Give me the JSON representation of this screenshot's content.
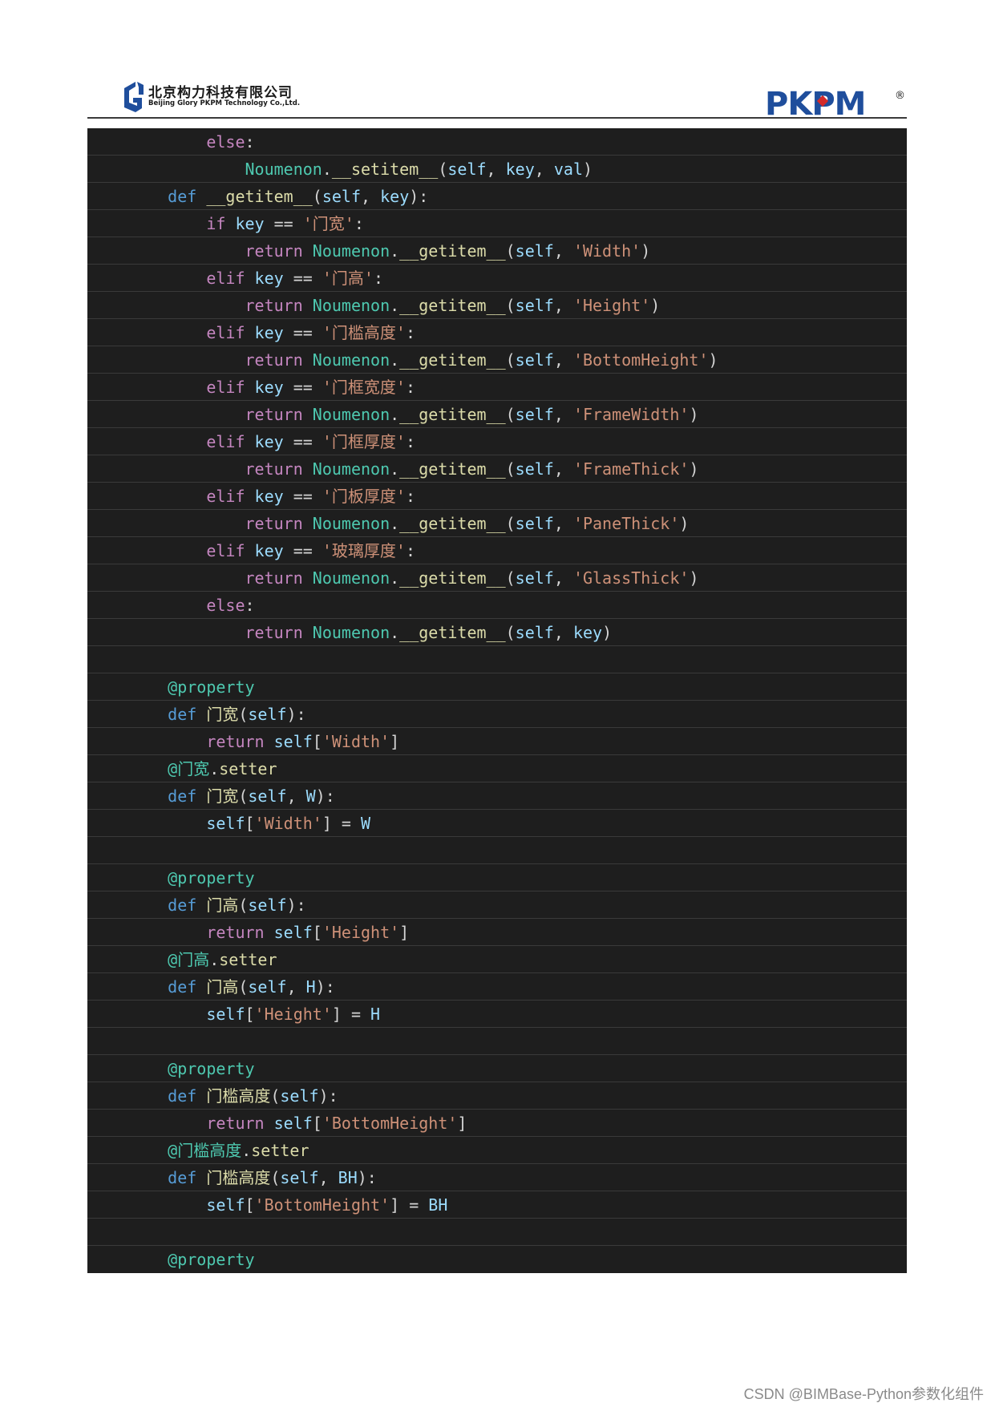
{
  "header": {
    "company_cn": "北京构力科技有限公司",
    "company_en": "Beijing Glory PKPM Technology Co.,Ltd.",
    "brand": "PKPM",
    "brand_mark": "®"
  },
  "code_lines": [
    [
      [
        "        ",
        "p"
      ],
      [
        "else",
        "kw"
      ],
      [
        ":",
        "p"
      ]
    ],
    [
      [
        "            ",
        "p"
      ],
      [
        "Noumenon",
        "cls"
      ],
      [
        ".",
        "p"
      ],
      [
        "__setitem__",
        "fn"
      ],
      [
        "(",
        "p"
      ],
      [
        "self",
        "var"
      ],
      [
        ", ",
        "p"
      ],
      [
        "key",
        "var"
      ],
      [
        ", ",
        "p"
      ],
      [
        "val",
        "var"
      ],
      [
        ")",
        "p"
      ]
    ],
    [
      [
        "    ",
        "p"
      ],
      [
        "def",
        "def"
      ],
      [
        " ",
        "p"
      ],
      [
        "__getitem__",
        "fn"
      ],
      [
        "(",
        "p"
      ],
      [
        "self",
        "var"
      ],
      [
        ", ",
        "p"
      ],
      [
        "key",
        "var"
      ],
      [
        "):",
        "p"
      ]
    ],
    [
      [
        "        ",
        "p"
      ],
      [
        "if",
        "kw"
      ],
      [
        " ",
        "p"
      ],
      [
        "key",
        "var"
      ],
      [
        " == ",
        "p"
      ],
      [
        "'门宽'",
        "str"
      ],
      [
        ":",
        "p"
      ]
    ],
    [
      [
        "            ",
        "p"
      ],
      [
        "return",
        "kw"
      ],
      [
        " ",
        "p"
      ],
      [
        "Noumenon",
        "cls"
      ],
      [
        ".",
        "p"
      ],
      [
        "__getitem__",
        "fn"
      ],
      [
        "(",
        "p"
      ],
      [
        "self",
        "var"
      ],
      [
        ", ",
        "p"
      ],
      [
        "'Width'",
        "str"
      ],
      [
        ")",
        "p"
      ]
    ],
    [
      [
        "        ",
        "p"
      ],
      [
        "elif",
        "kw"
      ],
      [
        " ",
        "p"
      ],
      [
        "key",
        "var"
      ],
      [
        " == ",
        "p"
      ],
      [
        "'门高'",
        "str"
      ],
      [
        ":",
        "p"
      ]
    ],
    [
      [
        "            ",
        "p"
      ],
      [
        "return",
        "kw"
      ],
      [
        " ",
        "p"
      ],
      [
        "Noumenon",
        "cls"
      ],
      [
        ".",
        "p"
      ],
      [
        "__getitem__",
        "fn"
      ],
      [
        "(",
        "p"
      ],
      [
        "self",
        "var"
      ],
      [
        ", ",
        "p"
      ],
      [
        "'Height'",
        "str"
      ],
      [
        ")",
        "p"
      ]
    ],
    [
      [
        "        ",
        "p"
      ],
      [
        "elif",
        "kw"
      ],
      [
        " ",
        "p"
      ],
      [
        "key",
        "var"
      ],
      [
        " == ",
        "p"
      ],
      [
        "'门槛高度'",
        "str"
      ],
      [
        ":",
        "p"
      ]
    ],
    [
      [
        "            ",
        "p"
      ],
      [
        "return",
        "kw"
      ],
      [
        " ",
        "p"
      ],
      [
        "Noumenon",
        "cls"
      ],
      [
        ".",
        "p"
      ],
      [
        "__getitem__",
        "fn"
      ],
      [
        "(",
        "p"
      ],
      [
        "self",
        "var"
      ],
      [
        ", ",
        "p"
      ],
      [
        "'BottomHeight'",
        "str"
      ],
      [
        ")",
        "p"
      ]
    ],
    [
      [
        "        ",
        "p"
      ],
      [
        "elif",
        "kw"
      ],
      [
        " ",
        "p"
      ],
      [
        "key",
        "var"
      ],
      [
        " == ",
        "p"
      ],
      [
        "'门框宽度'",
        "str"
      ],
      [
        ":",
        "p"
      ]
    ],
    [
      [
        "            ",
        "p"
      ],
      [
        "return",
        "kw"
      ],
      [
        " ",
        "p"
      ],
      [
        "Noumenon",
        "cls"
      ],
      [
        ".",
        "p"
      ],
      [
        "__getitem__",
        "fn"
      ],
      [
        "(",
        "p"
      ],
      [
        "self",
        "var"
      ],
      [
        ", ",
        "p"
      ],
      [
        "'FrameWidth'",
        "str"
      ],
      [
        ")",
        "p"
      ]
    ],
    [
      [
        "        ",
        "p"
      ],
      [
        "elif",
        "kw"
      ],
      [
        " ",
        "p"
      ],
      [
        "key",
        "var"
      ],
      [
        " == ",
        "p"
      ],
      [
        "'门框厚度'",
        "str"
      ],
      [
        ":",
        "p"
      ]
    ],
    [
      [
        "            ",
        "p"
      ],
      [
        "return",
        "kw"
      ],
      [
        " ",
        "p"
      ],
      [
        "Noumenon",
        "cls"
      ],
      [
        ".",
        "p"
      ],
      [
        "__getitem__",
        "fn"
      ],
      [
        "(",
        "p"
      ],
      [
        "self",
        "var"
      ],
      [
        ", ",
        "p"
      ],
      [
        "'FrameThick'",
        "str"
      ],
      [
        ")",
        "p"
      ]
    ],
    [
      [
        "        ",
        "p"
      ],
      [
        "elif",
        "kw"
      ],
      [
        " ",
        "p"
      ],
      [
        "key",
        "var"
      ],
      [
        " == ",
        "p"
      ],
      [
        "'门板厚度'",
        "str"
      ],
      [
        ":",
        "p"
      ]
    ],
    [
      [
        "            ",
        "p"
      ],
      [
        "return",
        "kw"
      ],
      [
        " ",
        "p"
      ],
      [
        "Noumenon",
        "cls"
      ],
      [
        ".",
        "p"
      ],
      [
        "__getitem__",
        "fn"
      ],
      [
        "(",
        "p"
      ],
      [
        "self",
        "var"
      ],
      [
        ", ",
        "p"
      ],
      [
        "'PaneThick'",
        "str"
      ],
      [
        ")",
        "p"
      ]
    ],
    [
      [
        "        ",
        "p"
      ],
      [
        "elif",
        "kw"
      ],
      [
        " ",
        "p"
      ],
      [
        "key",
        "var"
      ],
      [
        " == ",
        "p"
      ],
      [
        "'玻璃厚度'",
        "str"
      ],
      [
        ":",
        "p"
      ]
    ],
    [
      [
        "            ",
        "p"
      ],
      [
        "return",
        "kw"
      ],
      [
        " ",
        "p"
      ],
      [
        "Noumenon",
        "cls"
      ],
      [
        ".",
        "p"
      ],
      [
        "__getitem__",
        "fn"
      ],
      [
        "(",
        "p"
      ],
      [
        "self",
        "var"
      ],
      [
        ", ",
        "p"
      ],
      [
        "'GlassThick'",
        "str"
      ],
      [
        ")",
        "p"
      ]
    ],
    [
      [
        "        ",
        "p"
      ],
      [
        "else",
        "kw"
      ],
      [
        ":",
        "p"
      ]
    ],
    [
      [
        "            ",
        "p"
      ],
      [
        "return",
        "kw"
      ],
      [
        " ",
        "p"
      ],
      [
        "Noumenon",
        "cls"
      ],
      [
        ".",
        "p"
      ],
      [
        "__getitem__",
        "fn"
      ],
      [
        "(",
        "p"
      ],
      [
        "self",
        "var"
      ],
      [
        ", ",
        "p"
      ],
      [
        "key",
        "var"
      ],
      [
        ")",
        "p"
      ]
    ],
    [],
    [
      [
        "    ",
        "p"
      ],
      [
        "@property",
        "dec"
      ]
    ],
    [
      [
        "    ",
        "p"
      ],
      [
        "def",
        "def"
      ],
      [
        " ",
        "p"
      ],
      [
        "门宽",
        "fn"
      ],
      [
        "(",
        "p"
      ],
      [
        "self",
        "var"
      ],
      [
        "):",
        "p"
      ]
    ],
    [
      [
        "        ",
        "p"
      ],
      [
        "return",
        "kw"
      ],
      [
        " ",
        "p"
      ],
      [
        "self",
        "var"
      ],
      [
        "[",
        "p"
      ],
      [
        "'Width'",
        "str"
      ],
      [
        "]",
        "p"
      ]
    ],
    [
      [
        "    ",
        "p"
      ],
      [
        "@门宽",
        "dec"
      ],
      [
        ".",
        "p"
      ],
      [
        "setter",
        "fn"
      ]
    ],
    [
      [
        "    ",
        "p"
      ],
      [
        "def",
        "def"
      ],
      [
        " ",
        "p"
      ],
      [
        "门宽",
        "fn"
      ],
      [
        "(",
        "p"
      ],
      [
        "self",
        "var"
      ],
      [
        ", ",
        "p"
      ],
      [
        "W",
        "var"
      ],
      [
        "):",
        "p"
      ]
    ],
    [
      [
        "        ",
        "p"
      ],
      [
        "self",
        "var"
      ],
      [
        "[",
        "p"
      ],
      [
        "'Width'",
        "str"
      ],
      [
        "] = ",
        "p"
      ],
      [
        "W",
        "var"
      ]
    ],
    [],
    [
      [
        "    ",
        "p"
      ],
      [
        "@property",
        "dec"
      ]
    ],
    [
      [
        "    ",
        "p"
      ],
      [
        "def",
        "def"
      ],
      [
        " ",
        "p"
      ],
      [
        "门高",
        "fn"
      ],
      [
        "(",
        "p"
      ],
      [
        "self",
        "var"
      ],
      [
        "):",
        "p"
      ]
    ],
    [
      [
        "        ",
        "p"
      ],
      [
        "return",
        "kw"
      ],
      [
        " ",
        "p"
      ],
      [
        "self",
        "var"
      ],
      [
        "[",
        "p"
      ],
      [
        "'Height'",
        "str"
      ],
      [
        "]",
        "p"
      ]
    ],
    [
      [
        "    ",
        "p"
      ],
      [
        "@门高",
        "dec"
      ],
      [
        ".",
        "p"
      ],
      [
        "setter",
        "fn"
      ]
    ],
    [
      [
        "    ",
        "p"
      ],
      [
        "def",
        "def"
      ],
      [
        " ",
        "p"
      ],
      [
        "门高",
        "fn"
      ],
      [
        "(",
        "p"
      ],
      [
        "self",
        "var"
      ],
      [
        ", ",
        "p"
      ],
      [
        "H",
        "var"
      ],
      [
        "):",
        "p"
      ]
    ],
    [
      [
        "        ",
        "p"
      ],
      [
        "self",
        "var"
      ],
      [
        "[",
        "p"
      ],
      [
        "'Height'",
        "str"
      ],
      [
        "] = ",
        "p"
      ],
      [
        "H",
        "var"
      ]
    ],
    [],
    [
      [
        "    ",
        "p"
      ],
      [
        "@property",
        "dec"
      ]
    ],
    [
      [
        "    ",
        "p"
      ],
      [
        "def",
        "def"
      ],
      [
        " ",
        "p"
      ],
      [
        "门槛高度",
        "fn"
      ],
      [
        "(",
        "p"
      ],
      [
        "self",
        "var"
      ],
      [
        "):",
        "p"
      ]
    ],
    [
      [
        "        ",
        "p"
      ],
      [
        "return",
        "kw"
      ],
      [
        " ",
        "p"
      ],
      [
        "self",
        "var"
      ],
      [
        "[",
        "p"
      ],
      [
        "'BottomHeight'",
        "str"
      ],
      [
        "]",
        "p"
      ]
    ],
    [
      [
        "    ",
        "p"
      ],
      [
        "@门槛高度",
        "dec"
      ],
      [
        ".",
        "p"
      ],
      [
        "setter",
        "fn"
      ]
    ],
    [
      [
        "    ",
        "p"
      ],
      [
        "def",
        "def"
      ],
      [
        " ",
        "p"
      ],
      [
        "门槛高度",
        "fn"
      ],
      [
        "(",
        "p"
      ],
      [
        "self",
        "var"
      ],
      [
        ", ",
        "p"
      ],
      [
        "BH",
        "var"
      ],
      [
        "):",
        "p"
      ]
    ],
    [
      [
        "        ",
        "p"
      ],
      [
        "self",
        "var"
      ],
      [
        "[",
        "p"
      ],
      [
        "'BottomHeight'",
        "str"
      ],
      [
        "] = ",
        "p"
      ],
      [
        "BH",
        "var"
      ]
    ],
    [],
    [
      [
        "    ",
        "p"
      ],
      [
        "@property",
        "dec"
      ]
    ]
  ],
  "footer": {
    "watermark": "CSDN @BIMBase-Python参数化组件"
  }
}
